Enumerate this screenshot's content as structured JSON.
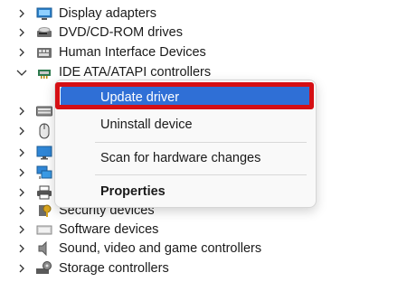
{
  "device_tree": {
    "items": [
      {
        "label": "Display adapters",
        "icon": "display-adapter-icon",
        "expanded": false
      },
      {
        "label": "DVD/CD-ROM drives",
        "icon": "dvd-drive-icon",
        "expanded": false
      },
      {
        "label": "Human Interface Devices",
        "icon": "hid-icon",
        "expanded": false
      },
      {
        "label": "IDE ATA/ATAPI controllers",
        "icon": "ide-controller-icon",
        "expanded": true
      },
      {
        "label": "",
        "icon": "keyboard-icon",
        "expanded": false
      },
      {
        "label": "",
        "icon": "mouse-icon",
        "expanded": false
      },
      {
        "label": "",
        "icon": "monitor-icon",
        "expanded": false
      },
      {
        "label": "",
        "icon": "network-adapter-icon",
        "expanded": false
      },
      {
        "label": "",
        "icon": "printer-icon",
        "expanded": false
      },
      {
        "label": "Security devices",
        "icon": "security-device-icon",
        "expanded": false
      },
      {
        "label": "Software devices",
        "icon": "software-device-icon",
        "expanded": false
      },
      {
        "label": "Sound, video and game controllers",
        "icon": "speaker-icon",
        "expanded": false
      },
      {
        "label": "Storage controllers",
        "icon": "storage-controller-icon",
        "expanded": false
      }
    ]
  },
  "context_menu": {
    "update_driver": "Update driver",
    "uninstall_device": "Uninstall device",
    "scan_hardware": "Scan for hardware changes",
    "properties": "Properties"
  },
  "colors": {
    "selection": "#2f6fd6",
    "annotation_box": "#d50f14"
  }
}
